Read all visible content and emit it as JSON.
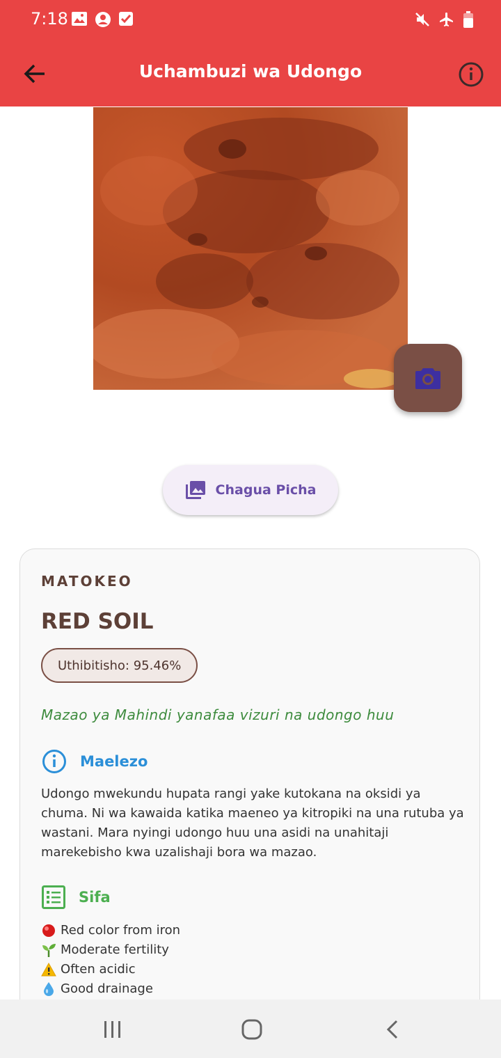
{
  "status_bar": {
    "time": "7:18"
  },
  "app_bar": {
    "title": "Uchambuzi wa Udongo"
  },
  "actions": {
    "pick_image_label": "Chagua Picha"
  },
  "result": {
    "heading": "MATOKEO",
    "soil_type": "RED SOIL",
    "confidence_label": "Uthibitisho: 95.46%",
    "confidence_value": 95.46,
    "crop_note": "Mazao ya Mahindi yanafaa vizuri na udongo huu",
    "description_title": "Maelezo",
    "description": "Udongo mwekundu hupata rangi yake kutokana na oksidi ya chuma. Ni wa kawaida katika maeneo ya kitropiki na una rutuba ya wastani. Mara nyingi udongo huu una asidi na unahitaji marekebisho kwa uzalishaji bora wa mazao.",
    "traits_title": "Sifa",
    "traits": [
      {
        "icon": "red-circle-icon",
        "text": "Red color from iron"
      },
      {
        "icon": "seedling-icon",
        "text": "Moderate fertility"
      },
      {
        "icon": "warning-icon",
        "text": "Often acidic"
      },
      {
        "icon": "droplet-icon",
        "text": "Good drainage"
      }
    ]
  },
  "colors": {
    "app_bar": "#e94444",
    "accent_purple": "#6a4fa8",
    "brown": "#5d4037",
    "camera_fab": "#7a4f45",
    "description_blue": "#2b8fd8",
    "traits_green": "#4caf50",
    "crop_note_green": "#3d8b3d"
  }
}
